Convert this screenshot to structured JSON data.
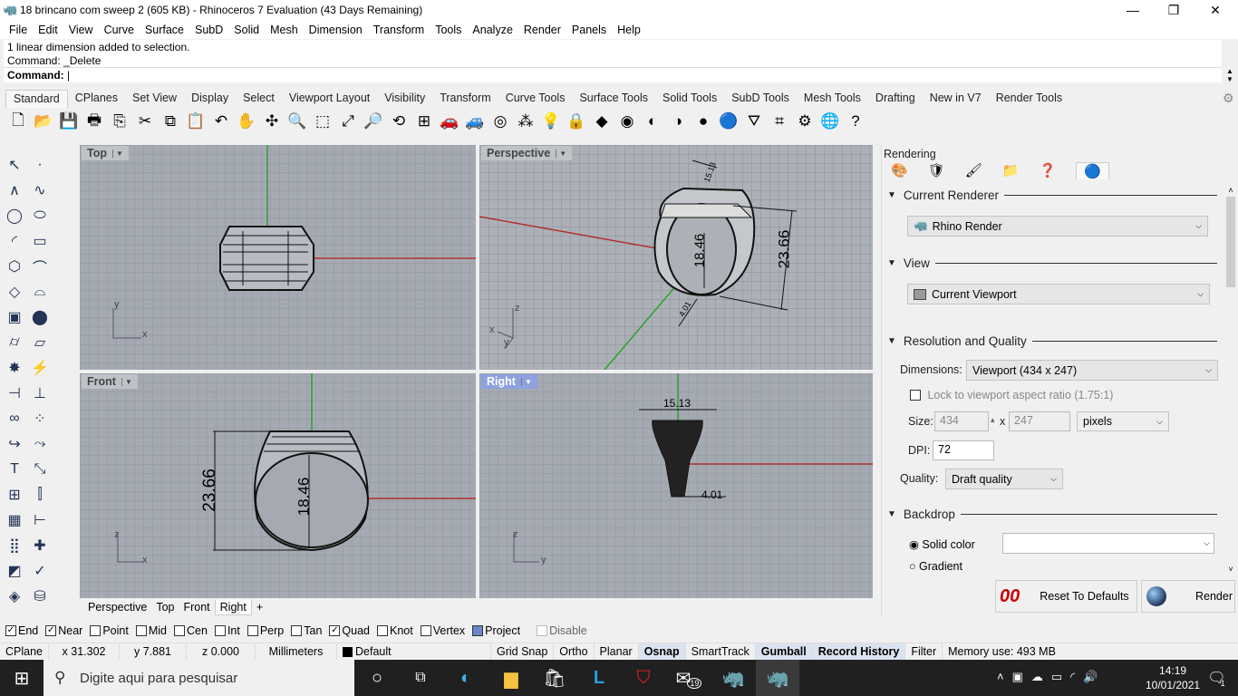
{
  "window": {
    "title": "18 brincano com sweep 2 (605 KB) - Rhinoceros 7 Evaluation (43 Days Remaining)",
    "minimize": "—",
    "maximize": "❐",
    "close": "✕"
  },
  "menu": [
    "File",
    "Edit",
    "View",
    "Curve",
    "Surface",
    "SubD",
    "Solid",
    "Mesh",
    "Dimension",
    "Transform",
    "Tools",
    "Analyze",
    "Render",
    "Panels",
    "Help"
  ],
  "command": {
    "history": [
      "1 linear dimension added to selection.",
      "Command: _Delete"
    ],
    "prompt": "Command:",
    "value": ""
  },
  "toolbar_tabs": [
    "Standard",
    "CPlanes",
    "Set View",
    "Display",
    "Select",
    "Viewport Layout",
    "Visibility",
    "Transform",
    "Curve Tools",
    "Surface Tools",
    "Solid Tools",
    "SubD Tools",
    "Mesh Tools",
    "Drafting",
    "New in V7",
    "Render Tools"
  ],
  "toolbar_icons": [
    [
      "new-icon",
      "🗋"
    ],
    [
      "open-icon",
      "📂"
    ],
    [
      "save-icon",
      "💾"
    ],
    [
      "print-icon",
      "🖶"
    ],
    [
      "import-icon",
      "⎘"
    ],
    [
      "cut-icon",
      "✂"
    ],
    [
      "copy-icon",
      "⧉"
    ],
    [
      "paste-icon",
      "📋"
    ],
    [
      "undo-icon",
      "↶"
    ],
    [
      "pan-icon",
      "✋"
    ],
    [
      "rotate-view-icon",
      "✣"
    ],
    [
      "zoom-icon",
      "🔍"
    ],
    [
      "zoom-window-icon",
      "⬚"
    ],
    [
      "zoom-extents-icon",
      "⤢"
    ],
    [
      "zoom-selected-icon",
      "🔎"
    ],
    [
      "rotate-icon",
      "⟲"
    ],
    [
      "four-viewports-icon",
      "⊞"
    ],
    [
      "car-icon",
      "🚗"
    ],
    [
      "car-ghost-icon",
      "🚙"
    ],
    [
      "cplane-icon",
      "◎"
    ],
    [
      "object-properties-icon",
      "⁂"
    ],
    [
      "light-icon",
      "💡"
    ],
    [
      "lock-icon",
      "🔒"
    ],
    [
      "layer-icon",
      "◆"
    ],
    [
      "color-wheel-icon",
      "◉"
    ],
    [
      "shaded-icon",
      "◐"
    ],
    [
      "render-preview-icon",
      "◑"
    ],
    [
      "rendered-icon",
      "●"
    ],
    [
      "render-sphere-icon",
      "🔵"
    ],
    [
      "filter-icon",
      "⛛"
    ],
    [
      "snap-icon",
      "⌗"
    ],
    [
      "options-icon",
      "⚙"
    ],
    [
      "earth-icon",
      "🌐"
    ],
    [
      "help-icon",
      "?"
    ]
  ],
  "left_icons": [
    [
      "select-icon",
      "↖"
    ],
    [
      "point-icon",
      "·"
    ],
    [
      "polyline-icon",
      "∧"
    ],
    [
      "curve-icon",
      "∿"
    ],
    [
      "circle-icon",
      "◯"
    ],
    [
      "ellipse-icon",
      "⬭"
    ],
    [
      "arc-icon",
      "◜"
    ],
    [
      "rectangle-icon",
      "▭"
    ],
    [
      "polygon-icon",
      "⬡"
    ],
    [
      "fillet-icon",
      "⌒"
    ],
    [
      "surface-icon",
      "◇"
    ],
    [
      "loft-icon",
      "⌓"
    ],
    [
      "box-icon",
      "▣"
    ],
    [
      "sphere-icon",
      "⬤"
    ],
    [
      "cylinder-icon",
      "⌭"
    ],
    [
      "plane-icon",
      "▱"
    ],
    [
      "boolean-icon",
      "✸"
    ],
    [
      "extrude-icon",
      "⚡"
    ],
    [
      "trim-icon",
      "⊣"
    ],
    [
      "split-icon",
      "⊥"
    ],
    [
      "join-icon",
      "∞"
    ],
    [
      "explode-icon",
      "⁘"
    ],
    [
      "fillet-edge-icon",
      "↪"
    ],
    [
      "offset-icon",
      "⤳"
    ],
    [
      "text-icon",
      "T"
    ],
    [
      "scale-icon",
      "⤡"
    ],
    [
      "array-icon",
      "⊞"
    ],
    [
      "align-icon",
      "⫿"
    ],
    [
      "mesh-icon",
      "▦"
    ],
    [
      "dimension-icon",
      "⊢"
    ],
    [
      "grid-array-icon",
      "⣿"
    ],
    [
      "gumball-icon",
      "✚"
    ],
    [
      "analyze-icon",
      "◩"
    ],
    [
      "check-icon",
      "✓"
    ],
    [
      "render-icon",
      "◈"
    ],
    [
      "paint-icon",
      "⛁"
    ]
  ],
  "viewports": {
    "top": {
      "title": "Top",
      "axes": [
        "y",
        "x"
      ]
    },
    "perspective": {
      "title": "Perspective",
      "axes": [
        "z",
        "x",
        "y"
      ],
      "dims": [
        "15.13",
        "18.46",
        "23.66",
        "4.01"
      ]
    },
    "front": {
      "title": "Front",
      "axes": [
        "z",
        "x"
      ],
      "dims": [
        "23.66",
        "18.46"
      ]
    },
    "right": {
      "title": "Right",
      "axes": [
        "z",
        "y"
      ],
      "dims": [
        "15.13",
        "4.01"
      ]
    }
  },
  "viewport_tabs": [
    "Perspective",
    "Top",
    "Front",
    "Right",
    "+"
  ],
  "panel": {
    "title": "Rendering",
    "current_renderer": {
      "label": "Current Renderer",
      "value": "Rhino Render"
    },
    "view": {
      "label": "View",
      "value": "Current Viewport"
    },
    "resolution": {
      "label": "Resolution and Quality",
      "dimensions_label": "Dimensions:",
      "dimensions_value": "Viewport (434 x 247)",
      "lock_label": "Lock to viewport aspect ratio (1.75:1)",
      "lock_checked": false,
      "size_label": "Size:",
      "width": "434",
      "x": "x",
      "height": "247",
      "units": "pixels",
      "dpi_label": "DPI:",
      "dpi": "72",
      "quality_label": "Quality:",
      "quality": "Draft quality"
    },
    "backdrop": {
      "label": "Backdrop",
      "solid": "Solid color",
      "gradient": "Gradient",
      "selected": "Solid color"
    },
    "reset_button": "Reset To Defaults",
    "reset_icon_text": "00",
    "render_button": "Render"
  },
  "osnaps": [
    {
      "label": "End",
      "checked": true
    },
    {
      "label": "Near",
      "checked": true
    },
    {
      "label": "Point",
      "checked": false
    },
    {
      "label": "Mid",
      "checked": false
    },
    {
      "label": "Cen",
      "checked": false
    },
    {
      "label": "Int",
      "checked": false
    },
    {
      "label": "Perp",
      "checked": false
    },
    {
      "label": "Tan",
      "checked": false
    },
    {
      "label": "Quad",
      "checked": true
    },
    {
      "label": "Knot",
      "checked": false
    },
    {
      "label": "Vertex",
      "checked": false
    },
    {
      "label": "Project",
      "checked": true
    },
    {
      "label": "Disable",
      "checked": false
    }
  ],
  "status": {
    "cplane": "CPlane",
    "x": "x 31.302",
    "y": "y 7.881",
    "z": "z 0.000",
    "units": "Millimeters",
    "layer": "Default",
    "grid_snap": "Grid Snap",
    "ortho": "Ortho",
    "planar": "Planar",
    "osnap": "Osnap",
    "smarttrack": "SmartTrack",
    "gumball": "Gumball",
    "record_history": "Record History",
    "filter": "Filter",
    "memory": "Memory use: 493 MB"
  },
  "taskbar": {
    "search_placeholder": "Digite aqui para pesquisar",
    "mail_badge": "19",
    "time": "14:19",
    "date": "10/01/2021",
    "notif_count": "1"
  },
  "colors": {
    "viewport_bg": "#a5aab2",
    "active_title": "#8ea2e0",
    "x_axis": "#b03030",
    "y_axis": "#2fa02f"
  }
}
